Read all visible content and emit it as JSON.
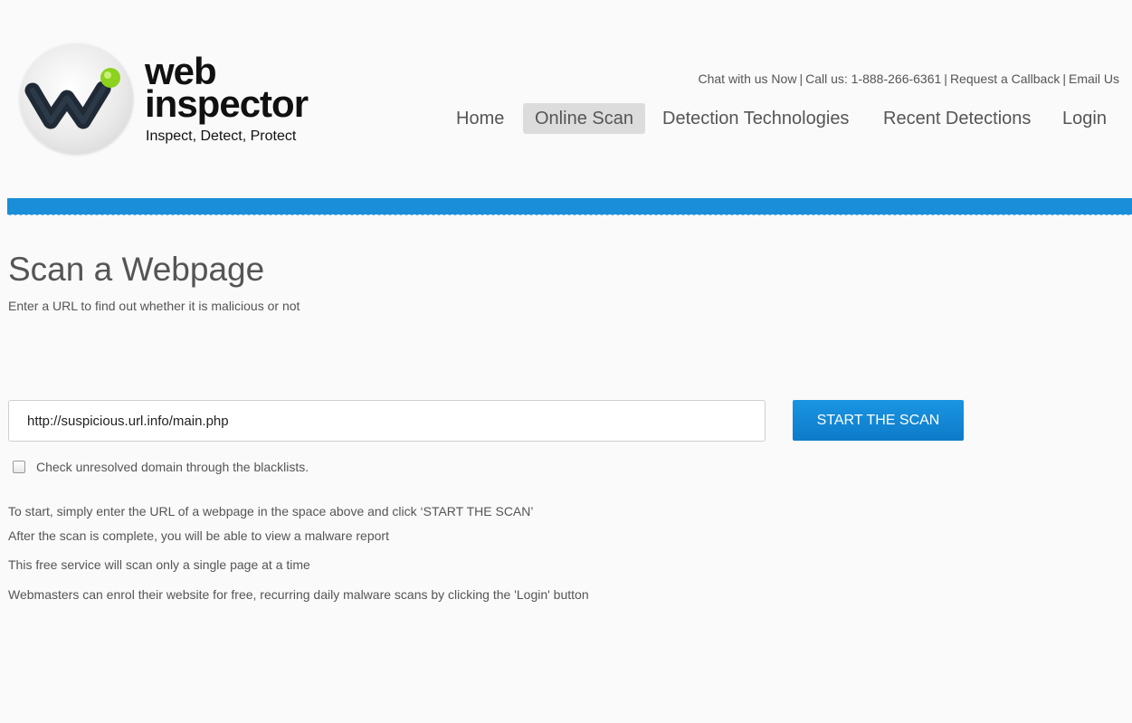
{
  "logo": {
    "word_1": "web",
    "word_2": "inspector",
    "tagline": "Inspect, Detect, Protect",
    "icon": "webinspector-w-logo-icon",
    "brand_colors": {
      "w_dark": "#1f2a36",
      "dot_green": "#8cd21e"
    }
  },
  "contact_bar": {
    "chat": "Chat with us Now",
    "call": "Call us: 1-888-266-6361",
    "callback": "Request a Callback",
    "email": "Email Us",
    "separator": "|"
  },
  "nav": {
    "items": [
      {
        "label": "Home",
        "active": false
      },
      {
        "label": "Online Scan",
        "active": true
      },
      {
        "label": "Detection Technologies",
        "active": false
      },
      {
        "label": "Recent Detections",
        "active": false
      },
      {
        "label": "Login",
        "active": false
      }
    ]
  },
  "colors": {
    "accent_blue": "#1a8ed8",
    "active_nav_bg": "#dcdcdc",
    "page_bg": "#fafafa"
  },
  "main": {
    "title": "Scan a Webpage",
    "subtitle": "Enter a URL to find out whether it is malicious or not",
    "url_value": "http://suspicious.url.info/main.php",
    "scan_button": "START THE SCAN",
    "checkbox_label": "Check unresolved domain through the blacklists.",
    "checkbox_checked": false,
    "info_lines": [
      "To start, simply enter the URL of a webpage in the space above and click ‘START THE SCAN’",
      "After the scan is complete, you will be able to view a malware report",
      "This free service will scan only a single page at a time",
      "Webmasters can enrol their website for free, recurring daily malware scans by clicking the 'Login' button"
    ]
  }
}
